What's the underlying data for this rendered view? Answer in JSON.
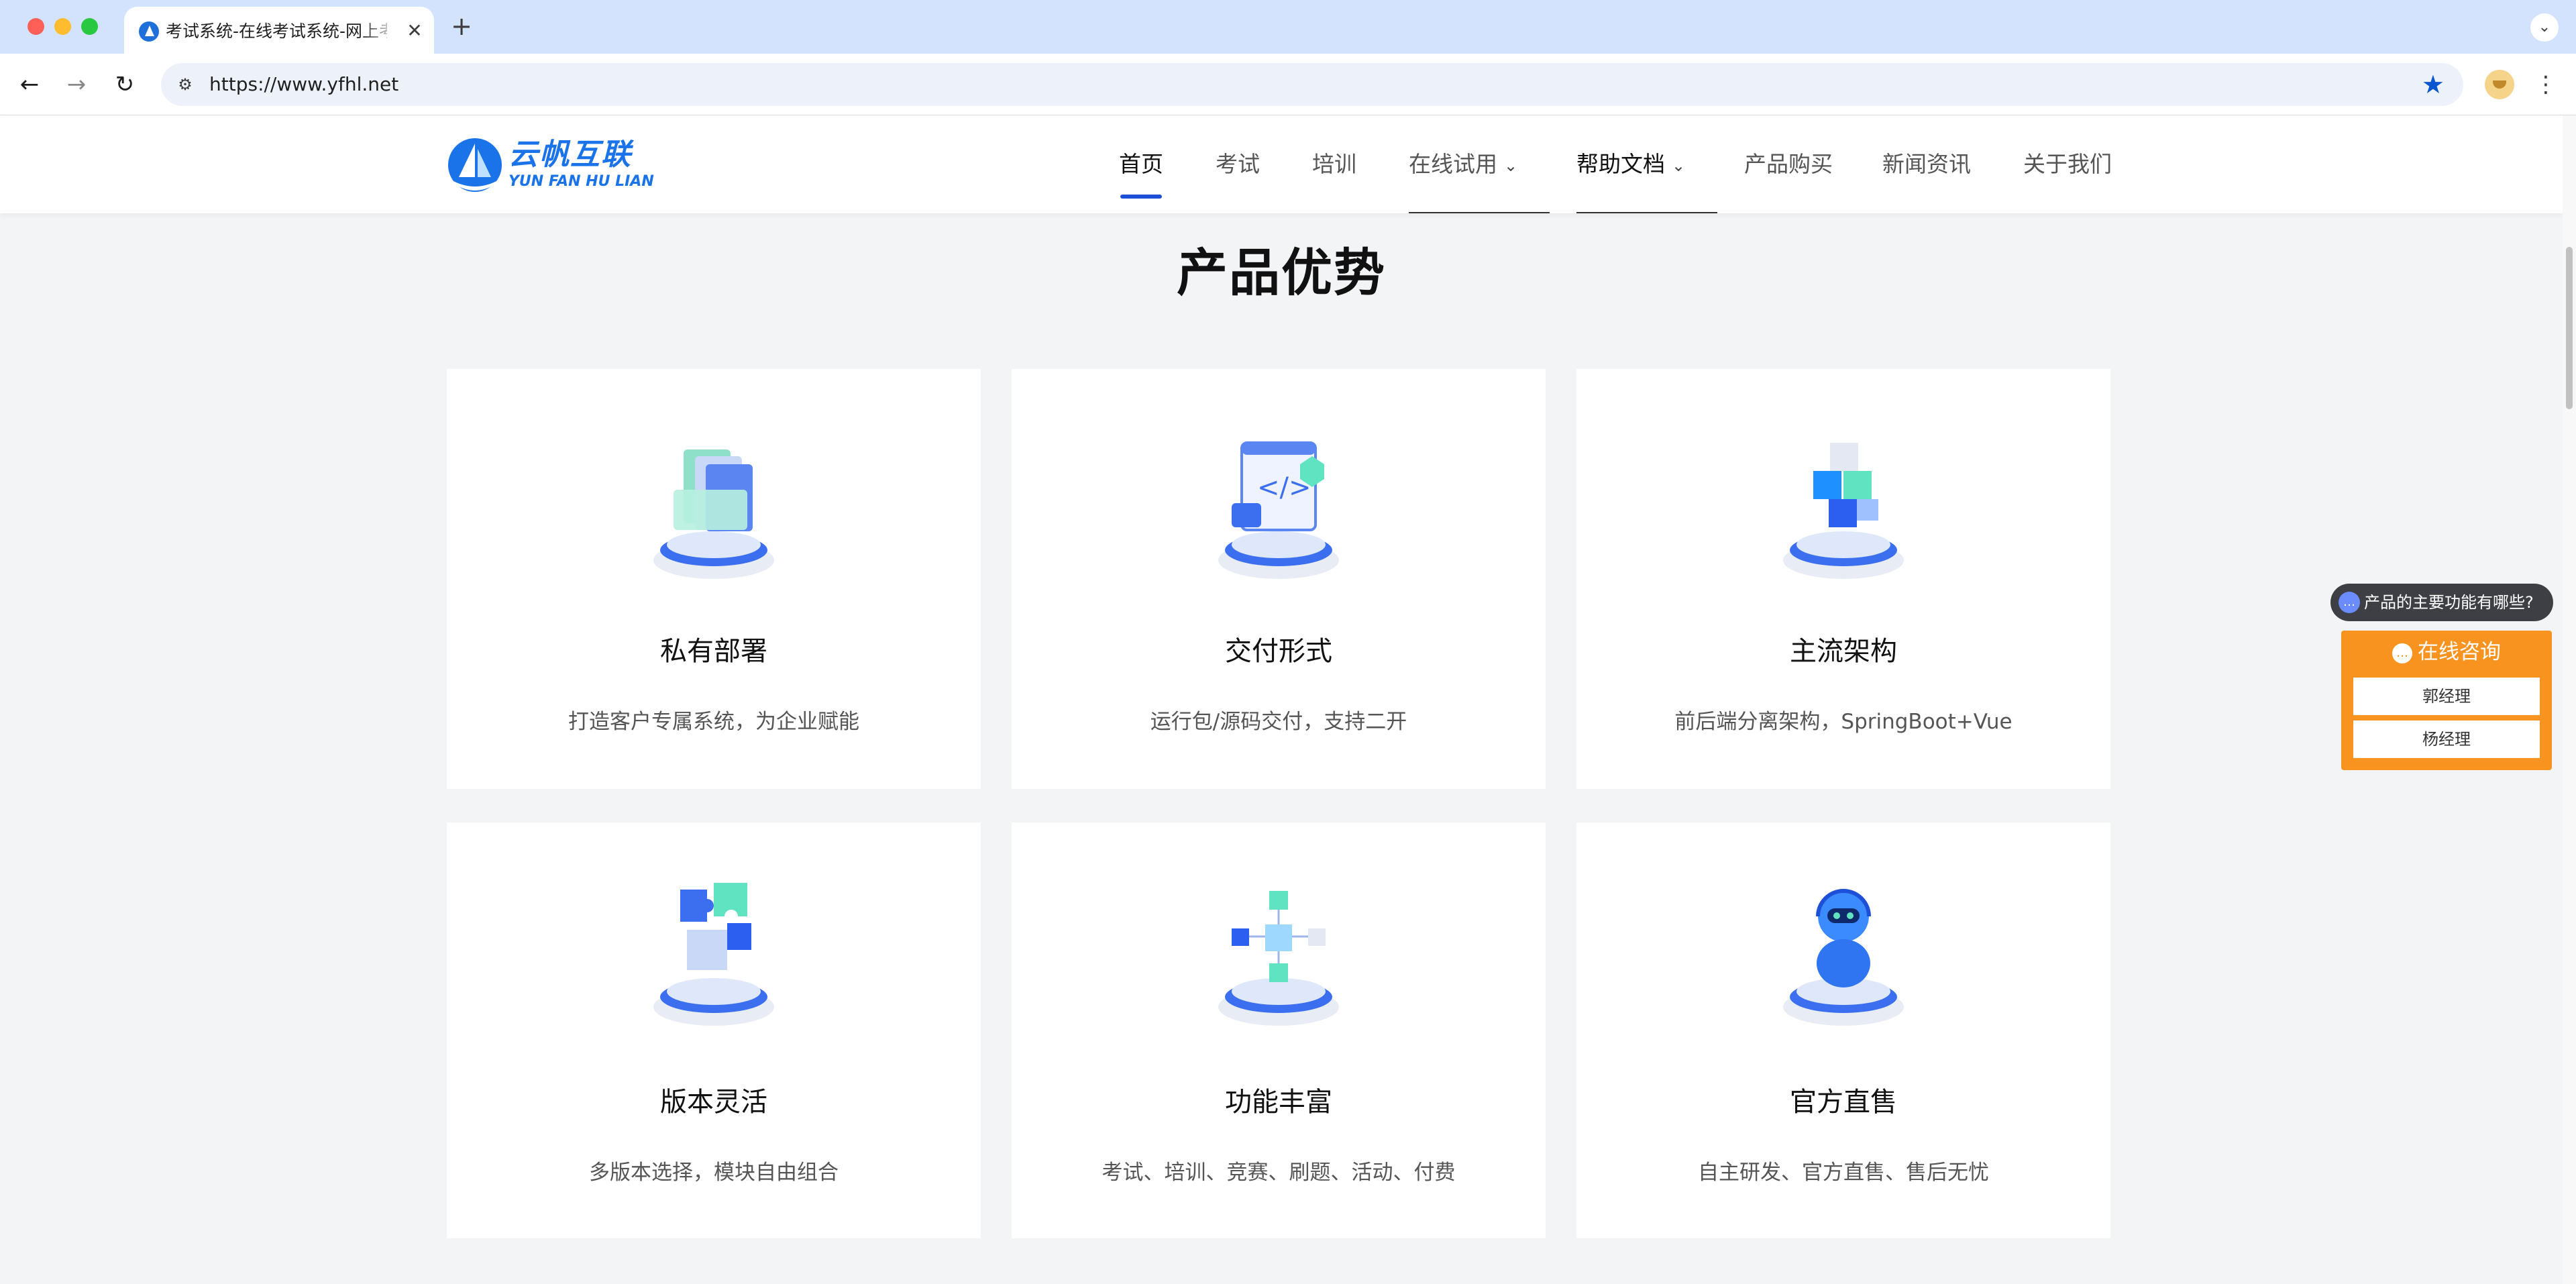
{
  "browser": {
    "tab_title": "考试系统-在线考试系统-网上考试系统",
    "url": "https://www.yfhl.net"
  },
  "site": {
    "logo_cn": "云帆互联",
    "logo_en": "YUN FAN HU LIAN",
    "nav": [
      "首页",
      "考试",
      "培训",
      "在线试用",
      "帮助文档",
      "产品购买",
      "新闻资讯",
      "关于我们"
    ]
  },
  "section": {
    "title": "产品优势",
    "cards": [
      {
        "title": "私有部署",
        "desc": "打造客户专属系统，为企业赋能",
        "icon": "folders-illustration-icon"
      },
      {
        "title": "交付形式",
        "desc": "运行包/源码交付，支持二开",
        "icon": "code-window-illustration-icon"
      },
      {
        "title": "主流架构",
        "desc": "前后端分离架构，SpringBoot+Vue",
        "icon": "cubes-illustration-icon"
      },
      {
        "title": "版本灵活",
        "desc": "多版本选择，模块自由组合",
        "icon": "puzzle-illustration-icon"
      },
      {
        "title": "功能丰富",
        "desc": "考试、培训、竞赛、刷题、活动、付费",
        "icon": "network-cubes-illustration-icon"
      },
      {
        "title": "官方直售",
        "desc": "自主研发、官方直售、售后无忧",
        "icon": "robot-illustration-icon"
      }
    ]
  },
  "widgets": {
    "chat_hint": "产品的主要功能有哪些?",
    "consult_title": "在线咨询",
    "consult_items": [
      "郭经理",
      "杨经理"
    ]
  },
  "colors": {
    "accent": "#1d4ed8",
    "consult": "#f7931e",
    "tabbar": "#d3e3fd"
  }
}
